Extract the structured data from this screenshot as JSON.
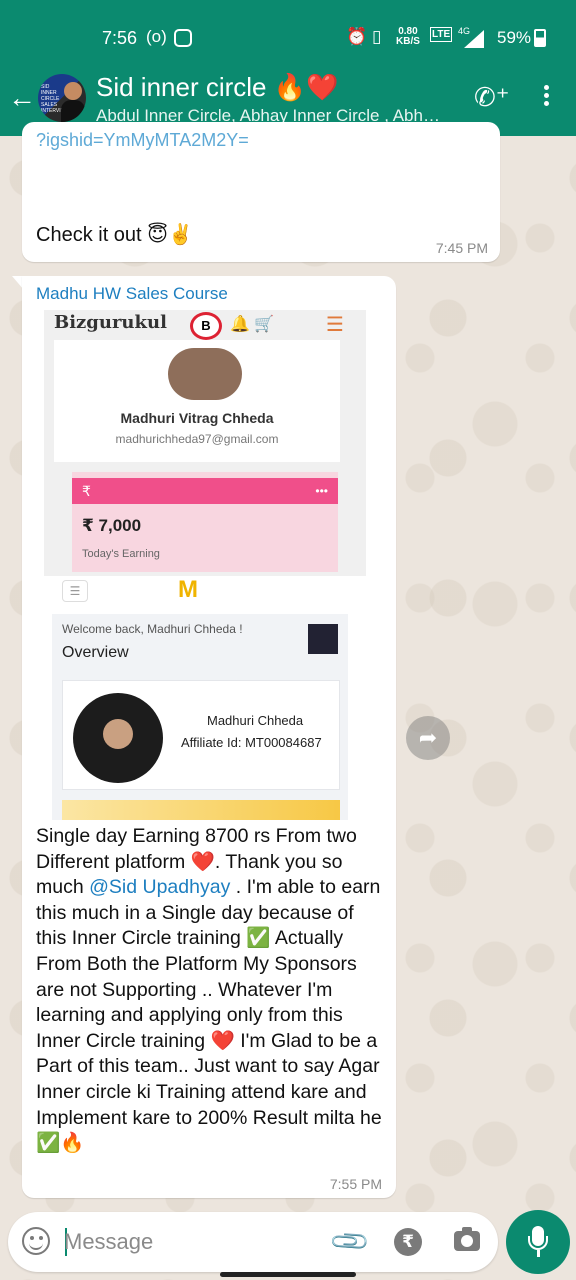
{
  "status_bar": {
    "time": "7:56",
    "network_speed": "0.80",
    "network_speed_unit": "KB/S",
    "network_type": "4G",
    "battery": "59%"
  },
  "header": {
    "title": "Sid inner circle 🔥❤️",
    "participants": "Abdul Inner Circle, Abhay Inner Circle , Abh…",
    "avatar_label": "SID INNER CIRCLE SALES INTERVIEW"
  },
  "messages": [
    {
      "link_fragment": "?igshid=YmMyMTA2M2Y=",
      "text": "Check it out 😇✌️",
      "time": "7:45 PM"
    },
    {
      "sender": "Madhu HW Sales Course",
      "image": {
        "brand": "Bizgurukul",
        "brand_logo": "B",
        "profile_name": "Madhuri Vitrag Chheda",
        "profile_email": "madhurichheda97@gmail.com",
        "earning_currency": "₹",
        "earning_menu": "•••",
        "earning_amount": "₹ 7,000",
        "earning_label": "Today's Earning",
        "logo2": "M",
        "welcome": "Welcome back, Madhuri Chheda !",
        "overview": "Overview",
        "affiliate_name": "Madhuri Chheda",
        "affiliate_id": "Affiliate Id: MT00084687"
      },
      "text_before_mention": "Single day Earning 8700 rs From two Different platform ❤️. Thank you so much ",
      "mention": "@Sid Upadhyay",
      "text_after_mention": " . I'm able to earn this much in a Single day because of this Inner Circle training ✅ Actually From Both the Platform My Sponsors are not Supporting .. Whatever I'm learning and applying only from this Inner Circle training ❤️ I'm Glad to be a Part of this team.. Just want to say Agar  Inner circle ki Training attend kare and Implement kare to 200% Result milta he ✅🔥",
      "time": "7:55 PM"
    }
  ],
  "composer": {
    "placeholder": "Message",
    "rupee_symbol": "₹"
  },
  "colors": {
    "header": "#0b8a6f",
    "mention": "#1e7fc0",
    "background": "#ece5dd"
  }
}
